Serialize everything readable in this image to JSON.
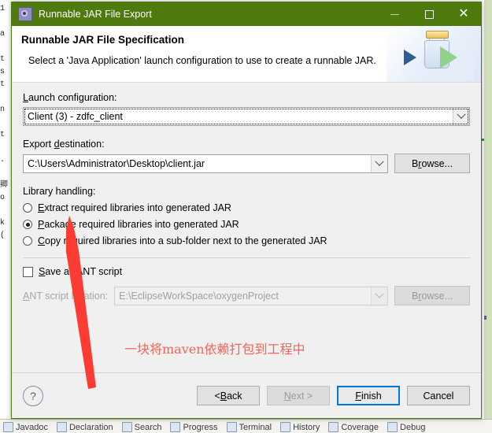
{
  "background": {
    "left_code_lines": [
      "1",
      "",
      "a",
      "",
      "t",
      "s",
      "t",
      "",
      "n",
      "",
      "t",
      "",
      ".",
      "",
      "卿",
      "o",
      "",
      "k",
      "(",
      "",
      "",
      "",
      ""
    ],
    "tabs": [
      {
        "label": "Javadoc",
        "icon": "at-icon"
      },
      {
        "label": "Declaration",
        "icon": "declaration-icon"
      },
      {
        "label": "Search",
        "icon": "search-icon"
      },
      {
        "label": "Progress",
        "icon": "progress-icon"
      },
      {
        "label": "Terminal",
        "icon": "terminal-icon"
      },
      {
        "label": "History",
        "icon": "history-icon"
      },
      {
        "label": "Coverage",
        "icon": "coverage-icon"
      },
      {
        "label": "Debug",
        "icon": "debug-icon"
      }
    ]
  },
  "window": {
    "title": "Runnable JAR File Export",
    "icon": "eclipse-wizard-icon",
    "minimize_label": "Minimize",
    "maximize_label": "Maximize",
    "close_label": "Close",
    "titlebar_color": "#4e7a0e"
  },
  "banner": {
    "title": "Runnable JAR File Specification",
    "description": "Select a 'Java Application' launch configuration to use to create a runnable JAR.",
    "icon": "jar-export-icon"
  },
  "launch_configuration": {
    "label_before": "",
    "label_mnemonic": "L",
    "label_after": "aunch configuration:",
    "value": "Client (3) - zdfc_client",
    "dropdown_icon": "chevron-down-icon"
  },
  "export_destination": {
    "label_before": "Export ",
    "label_mnemonic": "d",
    "label_after": "estination:",
    "value": "C:\\Users\\Administrator\\Desktop\\client.jar",
    "dropdown_icon": "chevron-down-icon",
    "browse_before": "B",
    "browse_mnemonic": "r",
    "browse_after": "owse..."
  },
  "library_handling": {
    "label": "Library handling:",
    "options": [
      {
        "before": "",
        "mnemonic": "E",
        "after": "xtract required libraries into generated JAR",
        "selected": false
      },
      {
        "before": "",
        "mnemonic": "P",
        "after": "ackage required libraries into generated JAR",
        "selected": true
      },
      {
        "before": "",
        "mnemonic": "C",
        "after": "opy required libraries into a sub-folder next to the generated JAR",
        "selected": false
      }
    ]
  },
  "ant_script": {
    "checkbox_before": "",
    "checkbox_mnemonic": "S",
    "checkbox_after": "ave as ANT script",
    "checked": false,
    "location_before": "",
    "location_mnemonic": "A",
    "location_after": "NT script location:",
    "location_value": "E:\\EclipseWorkSpace\\oxygenProject",
    "dropdown_icon": "chevron-down-icon",
    "browse_before": "B",
    "browse_mnemonic": "r",
    "browse_after": "owse...",
    "disabled": true
  },
  "annotation": {
    "text": "一块将maven依赖打包到工程中",
    "color": "#f4645a",
    "arrow_icon": "red-arrow-icon"
  },
  "footer": {
    "help_label": "?",
    "back_before": "< ",
    "back_mnemonic": "B",
    "back_after": "ack",
    "next_before": "",
    "next_mnemonic": "N",
    "next_after": "ext >",
    "next_disabled": true,
    "finish_before": "",
    "finish_mnemonic": "F",
    "finish_after": "inish",
    "finish_is_default": true,
    "cancel_label": "Cancel",
    "default_border_color": "#0078d7"
  }
}
